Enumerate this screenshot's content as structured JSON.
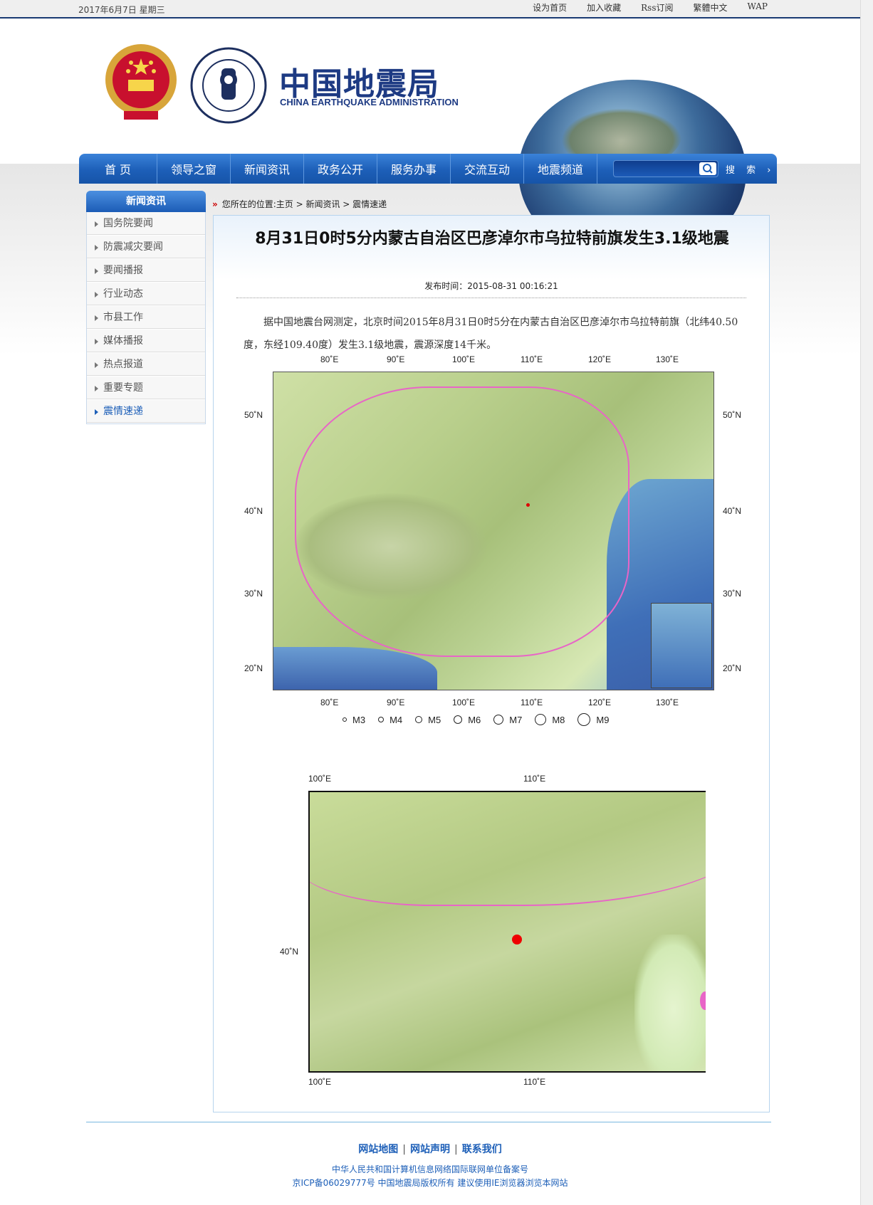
{
  "topbar": {
    "date": "2017年6月7日  星期三",
    "links": [
      "设为首页",
      "加入收藏",
      "Rss订阅",
      "繁體中文",
      "WAP"
    ]
  },
  "header": {
    "logo_cn": "中国地震局",
    "logo_en": "CHINA EARTHQUAKE ADMINISTRATION",
    "seal_text": "CHINA EARTHQUAKE ADMINISTRATION 中国地震局"
  },
  "nav": {
    "items": [
      "首  页",
      "领导之窗",
      "新闻资讯",
      "政务公开",
      "服务办事",
      "交流互动",
      "地震频道"
    ],
    "search_placeholder": "",
    "search_label": "搜 索 ›"
  },
  "sidebar": {
    "title": "新闻资讯",
    "items": [
      {
        "label": "国务院要闻",
        "active": false
      },
      {
        "label": "防震减灾要闻",
        "active": false
      },
      {
        "label": "要闻播报",
        "active": false
      },
      {
        "label": "行业动态",
        "active": false
      },
      {
        "label": "市县工作",
        "active": false
      },
      {
        "label": "媒体播报",
        "active": false
      },
      {
        "label": "热点报道",
        "active": false
      },
      {
        "label": "重要专题",
        "active": false
      },
      {
        "label": "震情速递",
        "active": true
      }
    ]
  },
  "breadcrumb": {
    "marker": "»",
    "text": "您所在的位置:主页 > 新闻资讯 > 震情速递"
  },
  "article": {
    "title": "8月31日0时5分内蒙古自治区巴彦淖尔市乌拉特前旗发生3.1级地震",
    "pubtime": "发布时间：2015-08-31 00:16:21",
    "body": "据中国地震台网测定，北京时间2015年8月31日0时5分在内蒙古自治区巴彦淖尔市乌拉特前旗（北纬40.50度，东经109.40度）发生3.1级地震，震源深度14千米。"
  },
  "map1": {
    "top_ticks": [
      "80˚E",
      "90˚E",
      "100˚E",
      "110˚E",
      "120˚E",
      "130˚E"
    ],
    "bottom_ticks": [
      "80˚E",
      "90˚E",
      "100˚E",
      "110˚E",
      "120˚E",
      "130˚E"
    ],
    "left_ticks": [
      "50˚N",
      "40˚N",
      "30˚N",
      "20˚N"
    ],
    "right_ticks": [
      "50˚N",
      "40˚N",
      "30˚N",
      "20˚N"
    ],
    "legend": [
      "M3",
      "M4",
      "M5",
      "M6",
      "M7",
      "M8",
      "M9"
    ]
  },
  "map2": {
    "top_ticks": [
      "100˚E",
      "110˚E"
    ],
    "bottom_ticks": [
      "100˚E",
      "110˚E"
    ],
    "left_ticks": [
      "40˚N"
    ]
  },
  "footer": {
    "links": [
      "网站地图",
      "网站声明",
      "联系我们"
    ],
    "line1": "中华人民共和国计算机信息网络国际联网单位备案号",
    "line2": "京ICP备06029777号  中国地震局版权所有  建议使用IE浏览器浏览本网站"
  },
  "colors": {
    "nav_blue": "#1d5fb8",
    "brand_navy": "#1d3a83",
    "border_pink": "#e865c7",
    "epicenter_red": "#e00000"
  }
}
